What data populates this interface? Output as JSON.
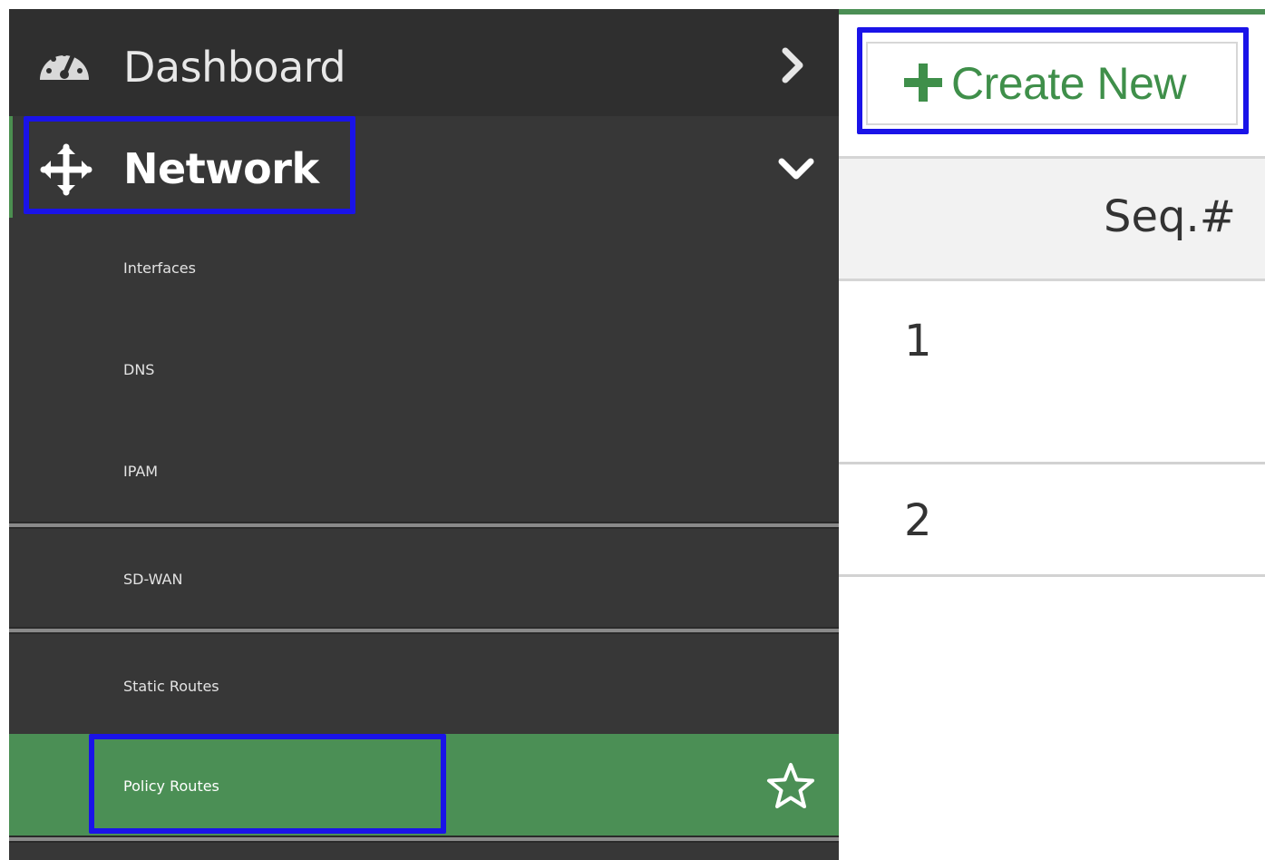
{
  "sidebar": {
    "dashboard": {
      "label": "Dashboard",
      "icon": "dashboard-icon",
      "chevron": "chevron-right-icon"
    },
    "network": {
      "label": "Network",
      "icon": "move-arrows-icon",
      "chevron": "chevron-down-icon"
    },
    "submenu": [
      {
        "label": "Interfaces"
      },
      {
        "label": "DNS"
      },
      {
        "label": "IPAM"
      },
      {
        "label": "SD-WAN"
      },
      {
        "label": "Static Routes"
      },
      {
        "label": "Policy Routes",
        "active": true,
        "icon": "star-outline-icon"
      }
    ]
  },
  "toolbar": {
    "create_label": "Create New",
    "create_icon": "plus-icon"
  },
  "table": {
    "columns": [
      "Seq.#"
    ],
    "rows": [
      {
        "seq": "1"
      },
      {
        "seq": "2"
      }
    ]
  },
  "colors": {
    "sidebar_bg": "#373737",
    "active_bg": "#4b8f55",
    "accent_green": "#3f8f4a",
    "highlight_blue": "#1a13e8"
  }
}
